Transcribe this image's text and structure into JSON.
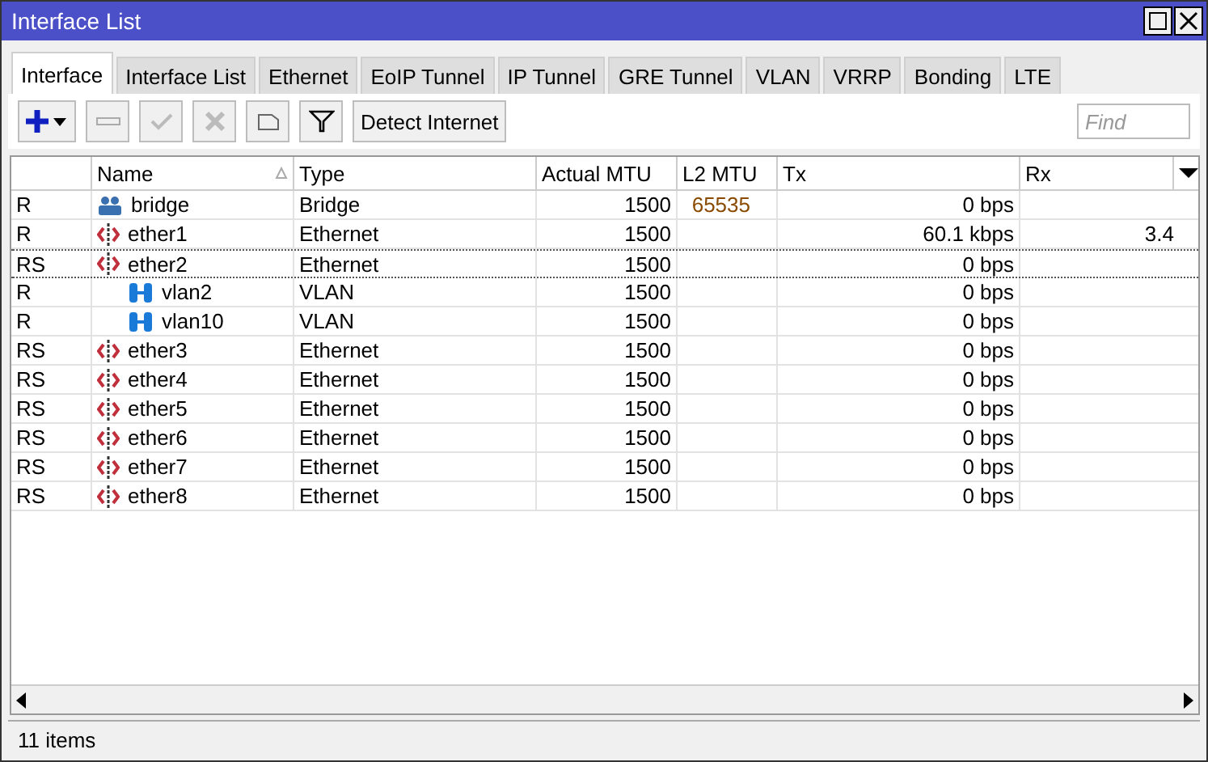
{
  "window": {
    "title": "Interface List"
  },
  "tabs": [
    {
      "label": "Interface",
      "selected": true
    },
    {
      "label": "Interface List",
      "selected": false
    },
    {
      "label": "Ethernet",
      "selected": false
    },
    {
      "label": "EoIP Tunnel",
      "selected": false
    },
    {
      "label": "IP Tunnel",
      "selected": false
    },
    {
      "label": "GRE Tunnel",
      "selected": false
    },
    {
      "label": "VLAN",
      "selected": false
    },
    {
      "label": "VRRP",
      "selected": false
    },
    {
      "label": "Bonding",
      "selected": false
    },
    {
      "label": "LTE",
      "selected": false
    }
  ],
  "toolbar": {
    "detect_button": "Detect Internet",
    "find": {
      "placeholder": "Find"
    }
  },
  "table": {
    "columns": [
      "Name",
      "Type",
      "Actual MTU",
      "L2 MTU",
      "Tx",
      "Rx"
    ],
    "rows": [
      {
        "flags": "R",
        "name": "bridge",
        "kind": "bridge",
        "type": "Bridge",
        "actual_mtu": "1500",
        "l2_mtu": "65535",
        "tx": "0 bps",
        "focused": false
      },
      {
        "flags": "R",
        "name": "ether1",
        "kind": "ethernet",
        "type": "Ethernet",
        "actual_mtu": "1500",
        "tx": "60.1 kbps",
        "rx": "3.4",
        "focused": false
      },
      {
        "flags": "RS",
        "name": "ether2",
        "kind": "ethernet",
        "type": "Ethernet",
        "actual_mtu": "1500",
        "tx": "0 bps",
        "focused": true,
        "children": [
          {
            "flags": "R",
            "name": "vlan2",
            "kind": "vlan",
            "type": "VLAN",
            "actual_mtu": "1500",
            "tx": "0 bps",
            "focused": false
          },
          {
            "flags": "R",
            "name": "vlan10",
            "kind": "vlan",
            "type": "VLAN",
            "actual_mtu": "1500",
            "tx": "0 bps",
            "focused": false
          }
        ]
      },
      {
        "flags": "RS",
        "name": "ether3",
        "kind": "ethernet",
        "type": "Ethernet",
        "actual_mtu": "1500",
        "tx": "0 bps",
        "focused": false
      },
      {
        "flags": "RS",
        "name": "ether4",
        "kind": "ethernet",
        "type": "Ethernet",
        "actual_mtu": "1500",
        "tx": "0 bps",
        "focused": false
      },
      {
        "flags": "RS",
        "name": "ether5",
        "kind": "ethernet",
        "type": "Ethernet",
        "actual_mtu": "1500",
        "tx": "0 bps",
        "focused": false
      },
      {
        "flags": "RS",
        "name": "ether6",
        "kind": "ethernet",
        "type": "Ethernet",
        "actual_mtu": "1500",
        "tx": "0 bps",
        "focused": false
      },
      {
        "flags": "RS",
        "name": "ether7",
        "kind": "ethernet",
        "type": "Ethernet",
        "actual_mtu": "1500",
        "tx": "0 bps",
        "focused": false
      },
      {
        "flags": "RS",
        "name": "ether8",
        "kind": "ethernet",
        "type": "Ethernet",
        "actual_mtu": "1500",
        "tx": "0 bps",
        "focused": false
      }
    ]
  },
  "status_bar": "11 items"
}
